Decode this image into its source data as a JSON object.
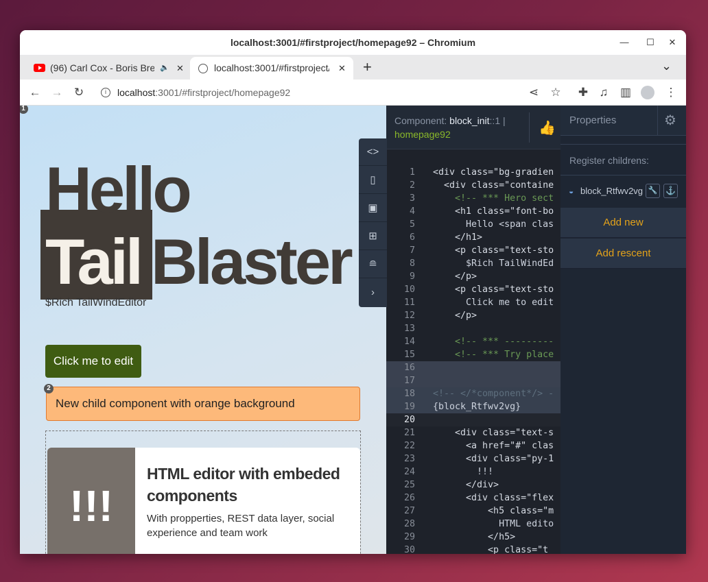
{
  "window": {
    "title": "localhost:3001/#firstproject/homepage92 – Chromium",
    "minimize": "—",
    "maximize": "☐",
    "close": "✕"
  },
  "tabs": [
    {
      "title": "(96) Carl Cox - Boris Brejcha",
      "audio": "🔈",
      "close": "✕"
    },
    {
      "title": "localhost:3001/#firstproject/homepage92",
      "close": "✕"
    }
  ],
  "tabbar": {
    "new_tab": "+",
    "tab_search": "⌄"
  },
  "toolbar": {
    "url_host": "localhost",
    "url_path": ":3001/#firstproject/homepage92"
  },
  "preview": {
    "badge1": "1",
    "badge2": "2",
    "hello": "Hello",
    "tail": "Tail",
    "blaster": "Blaster",
    "subtitle": "$Rich TailWindEditor",
    "button": "Click me to edit",
    "child": "New child component with orange background",
    "card": {
      "image_text": "!!!",
      "title": "HTML editor with embeded components",
      "text": "With propperties, REST data layer, social experience and team work"
    }
  },
  "editor": {
    "label": "Component: ",
    "component": "block_init",
    "suffix": "::1 |",
    "page": "homepage92",
    "lines": [
      {
        "n": "1",
        "t": "<div class=\"bg-gradien"
      },
      {
        "n": "2",
        "t": "  <div class=\"containe"
      },
      {
        "n": "3",
        "t": "    <!-- *** Hero sect"
      },
      {
        "n": "4",
        "t": "    <h1 class=\"font-bo"
      },
      {
        "n": "5",
        "t": "      Hello <span clas"
      },
      {
        "n": "6",
        "t": "    </h1>"
      },
      {
        "n": "7",
        "t": "    <p class=\"text-sto"
      },
      {
        "n": "8",
        "t": "      $Rich TailWindEd"
      },
      {
        "n": "9",
        "t": "    </p>"
      },
      {
        "n": "10",
        "t": "    <p class=\"text-sto"
      },
      {
        "n": "11",
        "t": "      Click me to edit"
      },
      {
        "n": "12",
        "t": "    </p>"
      },
      {
        "n": "13",
        "t": ""
      },
      {
        "n": "14",
        "t": "    <!-- *** ---------"
      },
      {
        "n": "15",
        "t": "    <!-- *** Try place"
      },
      {
        "n": "16",
        "t": ""
      },
      {
        "n": "17",
        "t": ""
      },
      {
        "n": "18",
        "t": "<!-- </*component*/> -"
      },
      {
        "n": "19",
        "t": "{block_Rtfwv2vg}"
      },
      {
        "n": "20",
        "t": ""
      },
      {
        "n": "21",
        "t": "    <div class=\"text-s"
      },
      {
        "n": "22",
        "t": "      <a href=\"#\" clas"
      },
      {
        "n": "23",
        "t": "      <div class=\"py-1"
      },
      {
        "n": "24",
        "t": "        !!!"
      },
      {
        "n": "25",
        "t": "      </div>"
      },
      {
        "n": "26",
        "t": "      <div class=\"flex"
      },
      {
        "n": "27",
        "t": "          <h5 class=\"m"
      },
      {
        "n": "28",
        "t": "            HTML edito"
      },
      {
        "n": "29",
        "t": "          </h5>"
      },
      {
        "n": "30",
        "t": "          <p class=\"t"
      }
    ]
  },
  "properties": {
    "title": "Properties",
    "register": "Register childrens:",
    "child_name": "block_Rtfwv2vg",
    "add_new": "Add new",
    "add_recent": "Add rescent"
  },
  "colors": {
    "accent_orange": "#e3a21a",
    "code_bg": "#1e222a",
    "green_button": "#3f5c12",
    "orange_child": "#fdb97a"
  }
}
